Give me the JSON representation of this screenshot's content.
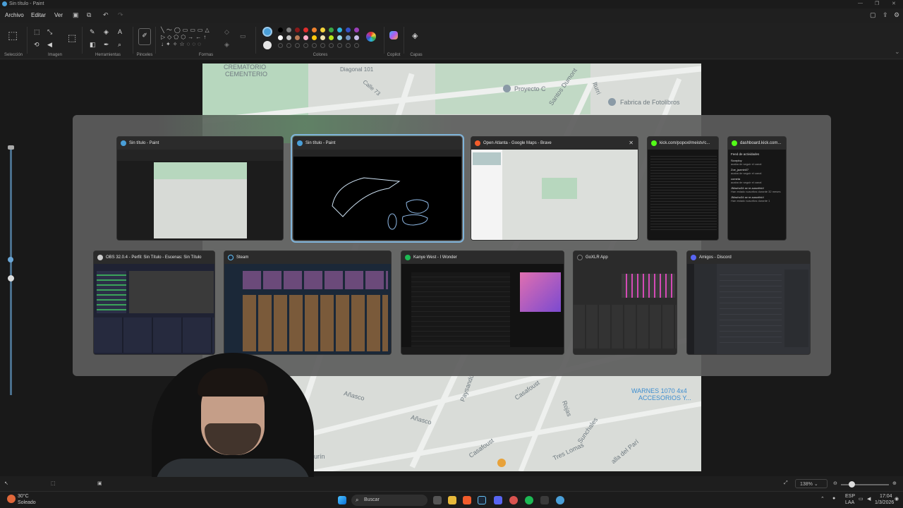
{
  "titlebar": {
    "title": "Sin título - Paint"
  },
  "menu": {
    "file": "Archivo",
    "edit": "Editar",
    "view": "Ver"
  },
  "ribbon": {
    "groups": {
      "selection": "Selección",
      "image": "Imagen",
      "tools": "Herramientas",
      "brushes": "Pinceles",
      "shapes": "Formas",
      "colors": "Colores",
      "copilot": "Copilot",
      "layers": "Capas"
    }
  },
  "map": {
    "labels": {
      "crematorio": "CREMATORIO",
      "cementerio": "CEMENTERIO",
      "diagonal": "Diagonal 101",
      "calle73": "Calle 73",
      "proyecto": "Proyecto C",
      "santos": "Santos Dumont",
      "ituri": "Iturri",
      "fabrica": "Fabrica de Fotolibros",
      "warnes": "WARNES 1070 4x4",
      "accesorios": "ACCESORIOS Y...",
      "anasco1": "Añasco",
      "anasco2": "Añasco",
      "paysandu": "Paysandú",
      "casafoust1": "Casafoust",
      "casafoust2": "Casafoust",
      "rojas": "Rojas",
      "sunchales": "Sunchales",
      "treslomas": "Tres Lomas",
      "maturin": "Maturín",
      "pari": "alla del Parí"
    }
  },
  "switcher": {
    "row1": [
      {
        "title": "Sin título - Paint",
        "icon_color": "#4a9fd8"
      },
      {
        "title": "Sin título - Paint",
        "icon_color": "#4a9fd8"
      },
      {
        "title": "Open Atlanta - Google Maps - Brave",
        "icon_color": "#f25c2b"
      },
      {
        "title": "kick.com/popoxl/meistv/c...",
        "icon_color": "#53fc18"
      },
      {
        "title": "dashboard.kick.com...",
        "icon_color": "#53fc18"
      }
    ],
    "row2": [
      {
        "title": "OBS 32.0.4 - Perfil: Sin Título - Escenas: Sin Título",
        "icon_color": "#cccccc"
      },
      {
        "title": "Steam",
        "icon_color": "#1b2838"
      },
      {
        "title": "Kanye West - I Wonder",
        "icon_color": "#1db954"
      },
      {
        "title": "GoXLR App",
        "icon_color": "#222222"
      },
      {
        "title": "Amigos - Discord",
        "icon_color": "#5865f2"
      }
    ],
    "close_icon": "close-icon"
  },
  "kick_feed": {
    "heading": "Feed de actividades",
    "items": [
      {
        "user": "Scorploy",
        "text": "acaba de seguir el canal"
      },
      {
        "user": "Zoe_jazmin07",
        "text": "acaba de seguir el canal"
      },
      {
        "user": "cometa",
        "text": "acaba de seguir el canal"
      },
      {
        "user": "JMacho34 se re-suscribió!",
        "text": "Han estado suscritos durante 32 meses"
      },
      {
        "user": "JMacho34 se re-suscribió!",
        "text": "Han estado suscritos durante 1"
      }
    ]
  },
  "status": {
    "zoom": "138%"
  },
  "taskbar": {
    "weather_temp": "30°C",
    "weather_desc": "Soleado",
    "search_placeholder": "Buscar",
    "lang1": "ESP",
    "lang2": "LAA",
    "time": "17:04",
    "date": "1/3/2026"
  }
}
